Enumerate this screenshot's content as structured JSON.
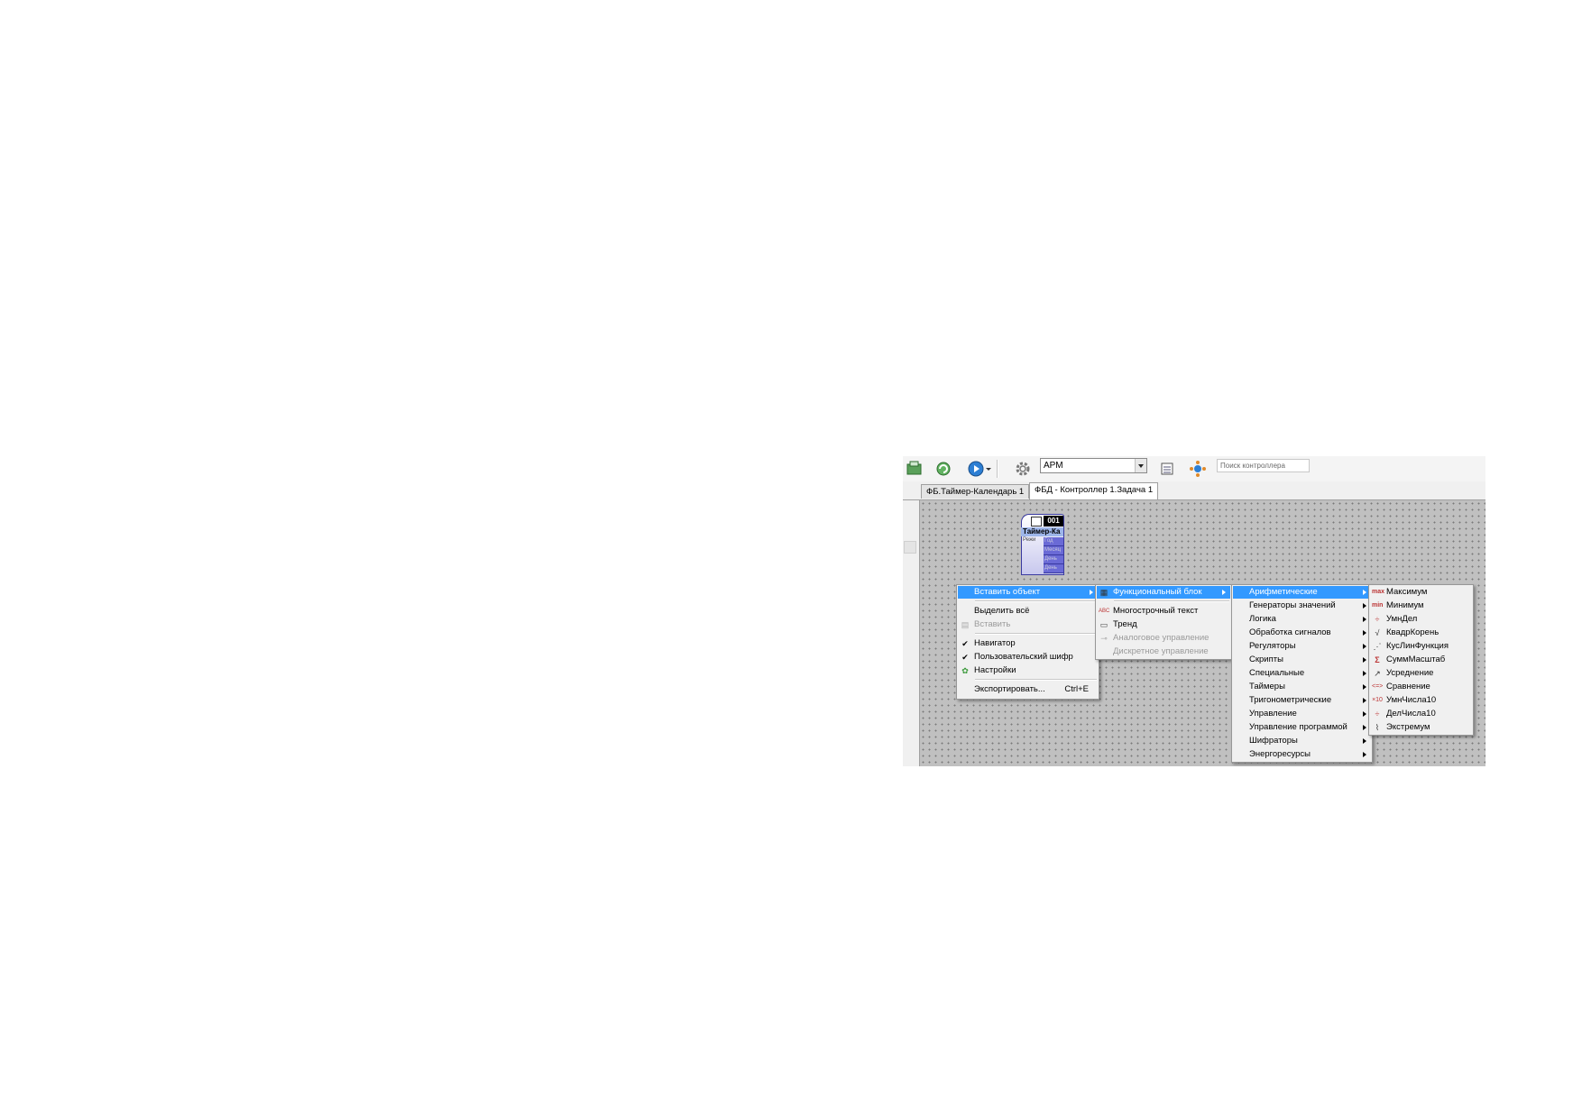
{
  "toolbar": {
    "combo_value": "АРМ",
    "search_placeholder": "Поиск контроллера",
    "icons": [
      "save-icon",
      "refresh-icon",
      "play-icon",
      "settings-icon",
      "list-icon",
      "network-icon"
    ]
  },
  "tabs": [
    {
      "label": "ФБ.Таймер-Календарь 1",
      "active": false
    },
    {
      "label": "ФБД - Контроллер 1.Задача 1",
      "active": true
    }
  ],
  "block": {
    "number": "001",
    "title": "Таймер-Ка",
    "input": "Режи",
    "outputs": [
      "Год",
      "Месяц",
      "День",
      "День"
    ]
  },
  "context_menu": {
    "items": [
      {
        "label": "Вставить объект",
        "submenu": true,
        "highlighted": true
      },
      {
        "label": "Выделить всё"
      },
      {
        "label": "Вставить",
        "disabled": true
      },
      {
        "label": "Навигатор",
        "checked": true
      },
      {
        "label": "Пользовательский шифр",
        "checked": true
      },
      {
        "label": "Настройки"
      },
      {
        "label": "Экспортировать...",
        "shortcut": "Ctrl+E"
      }
    ]
  },
  "insert_menu": {
    "items": [
      {
        "label": "Функциональный блок",
        "submenu": true,
        "highlighted": true
      },
      {
        "label": "Многострочный текст"
      },
      {
        "label": "Тренд"
      },
      {
        "label": "Аналоговое управление",
        "disabled": true
      },
      {
        "label": "Дискретное управление",
        "disabled": true
      }
    ]
  },
  "category_menu": {
    "items": [
      {
        "label": "Арифметические",
        "highlighted": true
      },
      {
        "label": "Генераторы значений"
      },
      {
        "label": "Логика"
      },
      {
        "label": "Обработка сигналов"
      },
      {
        "label": "Регуляторы"
      },
      {
        "label": "Скрипты"
      },
      {
        "label": "Специальные"
      },
      {
        "label": "Таймеры"
      },
      {
        "label": "Тригонометрические"
      },
      {
        "label": "Управление"
      },
      {
        "label": "Управление программой"
      },
      {
        "label": "Шифраторы"
      },
      {
        "label": "Энергоресурсы"
      }
    ]
  },
  "arith_menu": {
    "items": [
      {
        "label": "Максимум",
        "icon": "max-icon"
      },
      {
        "label": "Минимум",
        "icon": "min-icon"
      },
      {
        "label": "УмнДел",
        "icon": "muldiv-icon"
      },
      {
        "label": "КвадрКорень",
        "icon": "sqrt-icon"
      },
      {
        "label": "КусЛинФункция",
        "icon": "piecewise-icon"
      },
      {
        "label": "СуммМасштаб",
        "icon": "sigma-icon"
      },
      {
        "label": "Усреднение",
        "icon": "average-icon"
      },
      {
        "label": "Сравнение",
        "icon": "compare-icon"
      },
      {
        "label": "УмнЧисла10",
        "icon": "mul10-icon"
      },
      {
        "label": "ДелЧисла10",
        "icon": "div10-icon"
      },
      {
        "label": "Экстремум",
        "icon": "extremum-icon"
      }
    ]
  },
  "colors": {
    "highlight": "#3399ff",
    "canvas": "#c0c0c0",
    "block_output": "#6a6ad6"
  }
}
